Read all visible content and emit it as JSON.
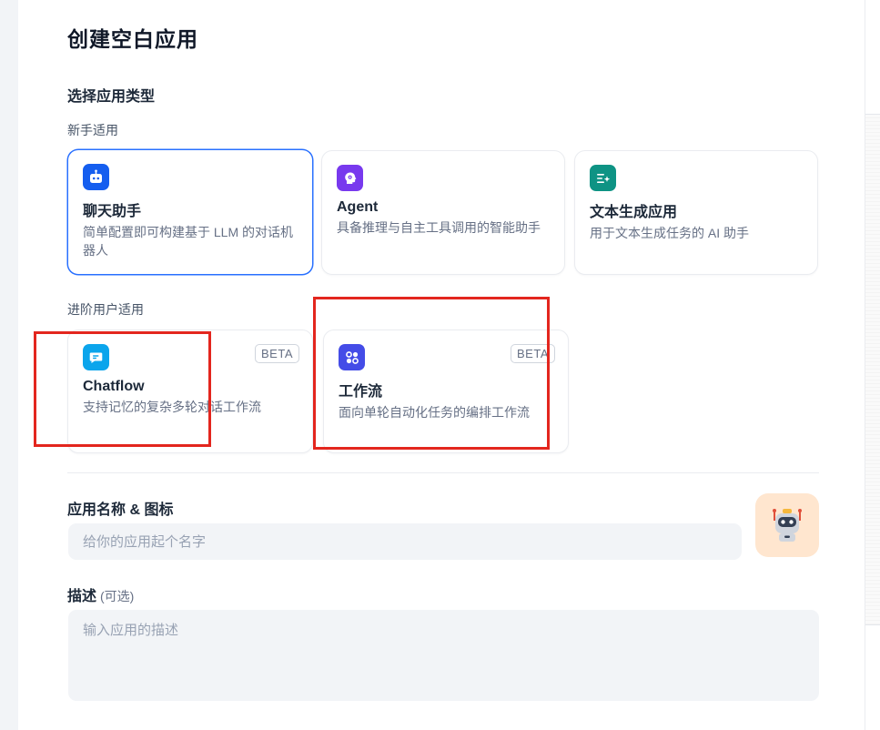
{
  "dialog": {
    "title": "创建空白应用",
    "section_title": "选择应用类型"
  },
  "groups": {
    "beginner_label": "新手适用",
    "advanced_label": "进阶用户适用"
  },
  "cards": {
    "chat": {
      "name": "聊天助手",
      "desc": "简单配置即可构建基于 LLM 的对话机器人",
      "icon": "robot-icon",
      "color": "#155eef"
    },
    "agent": {
      "name": "Agent",
      "desc": "具备推理与自主工具调用的智能助手",
      "icon": "brain-icon",
      "color": "#7839ee"
    },
    "completion": {
      "name": "文本生成应用",
      "desc": "用于文本生成任务的 AI 助手",
      "icon": "text-sparkle-icon",
      "color": "#0e9384"
    },
    "chatflow": {
      "name": "Chatflow",
      "desc": "支持记忆的复杂多轮对话工作流",
      "icon": "chat-bubble-icon",
      "color": "#0ba5ec",
      "badge": "BETA"
    },
    "workflow": {
      "name": "工作流",
      "desc": "面向单轮自动化任务的编排工作流",
      "icon": "workflow-icon",
      "color": "#444ce7",
      "badge": "BETA"
    }
  },
  "form": {
    "name_label": "应用名称 & 图标",
    "name_placeholder": "给你的应用起个名字",
    "desc_label": "描述",
    "desc_optional": "(可选)",
    "desc_placeholder": "输入应用的描述",
    "avatar": "robot-avatar-icon"
  },
  "colors": {
    "selected_border": "#2970ff",
    "highlight_box": "#e3261e",
    "avatar_bg": "#ffe6cf"
  }
}
